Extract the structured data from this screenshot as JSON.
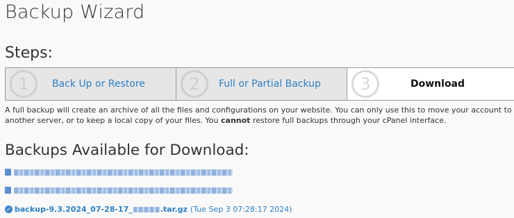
{
  "page": {
    "title": "Backup Wizard"
  },
  "steps": {
    "heading": "Steps:",
    "items": [
      {
        "number": "1",
        "label": "Back Up or Restore"
      },
      {
        "number": "2",
        "label": "Full or Partial Backup"
      },
      {
        "number": "3",
        "label": "Download"
      }
    ]
  },
  "description": {
    "part1": "A full backup will create an archive of all the files and configurations on your website. You can only use this to move your account to another server, or to keep a local copy of your files. You ",
    "bold": "cannot",
    "part2": " restore full backups through your cPanel interface."
  },
  "backups": {
    "heading": "Backups Available for Download:",
    "latest": {
      "name_prefix": "backup-9.3.2024_07-28-17_",
      "name_suffix": ".tar.gz",
      "timestamp": "(Tue Sep 3 07:28:17 2024)"
    }
  },
  "colors": {
    "link": "#2c7fc4",
    "done_step_bg": "#e6e6e6",
    "current_step_bg": "#ffffff"
  },
  "icons": [
    "document-icon",
    "check-circle-icon"
  ]
}
